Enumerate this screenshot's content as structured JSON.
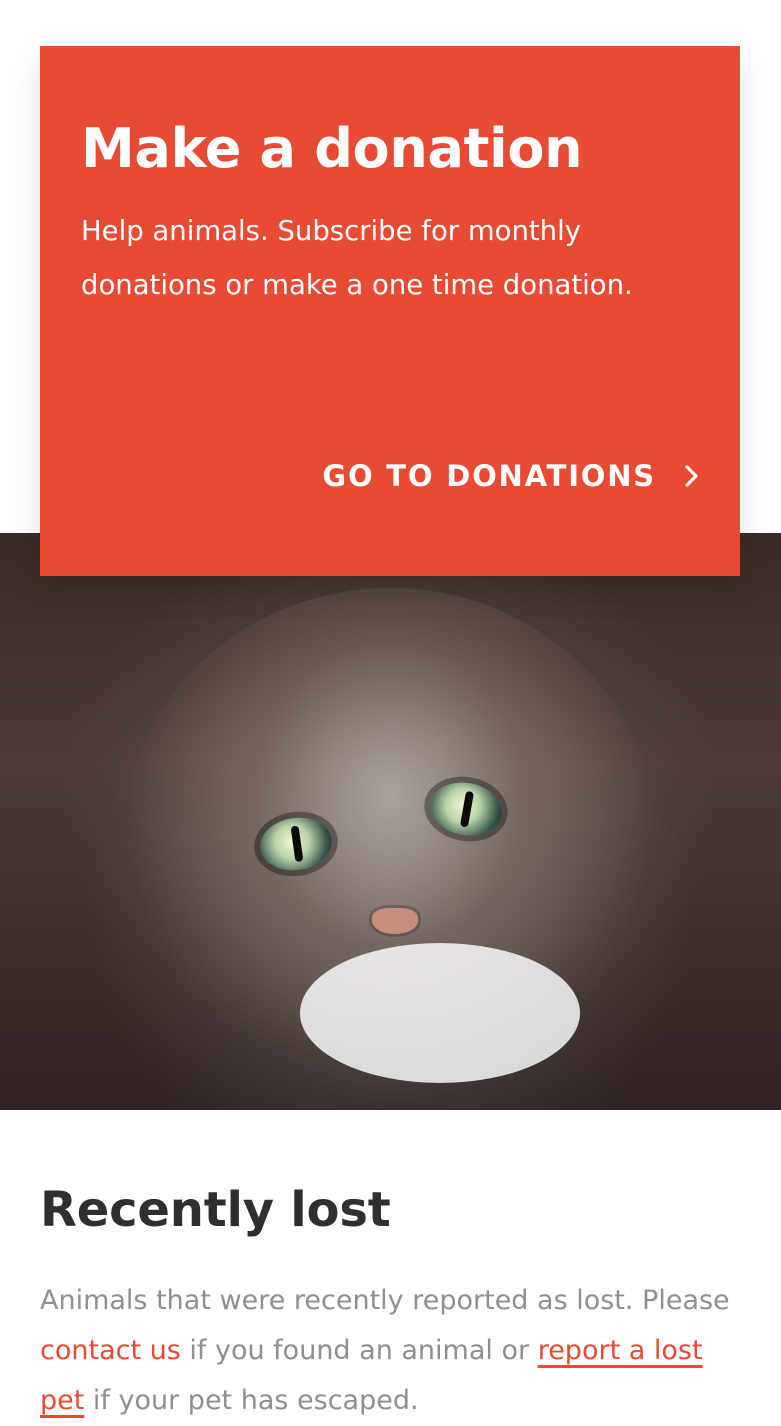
{
  "donation": {
    "title": "Make a donation",
    "description": "Help animals. Subscribe for monthly donations or make a one time donation.",
    "cta_label": "GO TO DONATIONS",
    "cta_icon": "chevron-right-icon",
    "card_color": "#e84a34"
  },
  "hero": {
    "image_alt": "cat"
  },
  "recently_lost": {
    "heading": "Recently lost",
    "text_part1": "Animals that were recently reported as lost. Please ",
    "link_contact": "contact us",
    "text_part2": " if you found an animal or ",
    "link_report": "report a lost pet",
    "text_part3": " if your pet has escaped."
  }
}
